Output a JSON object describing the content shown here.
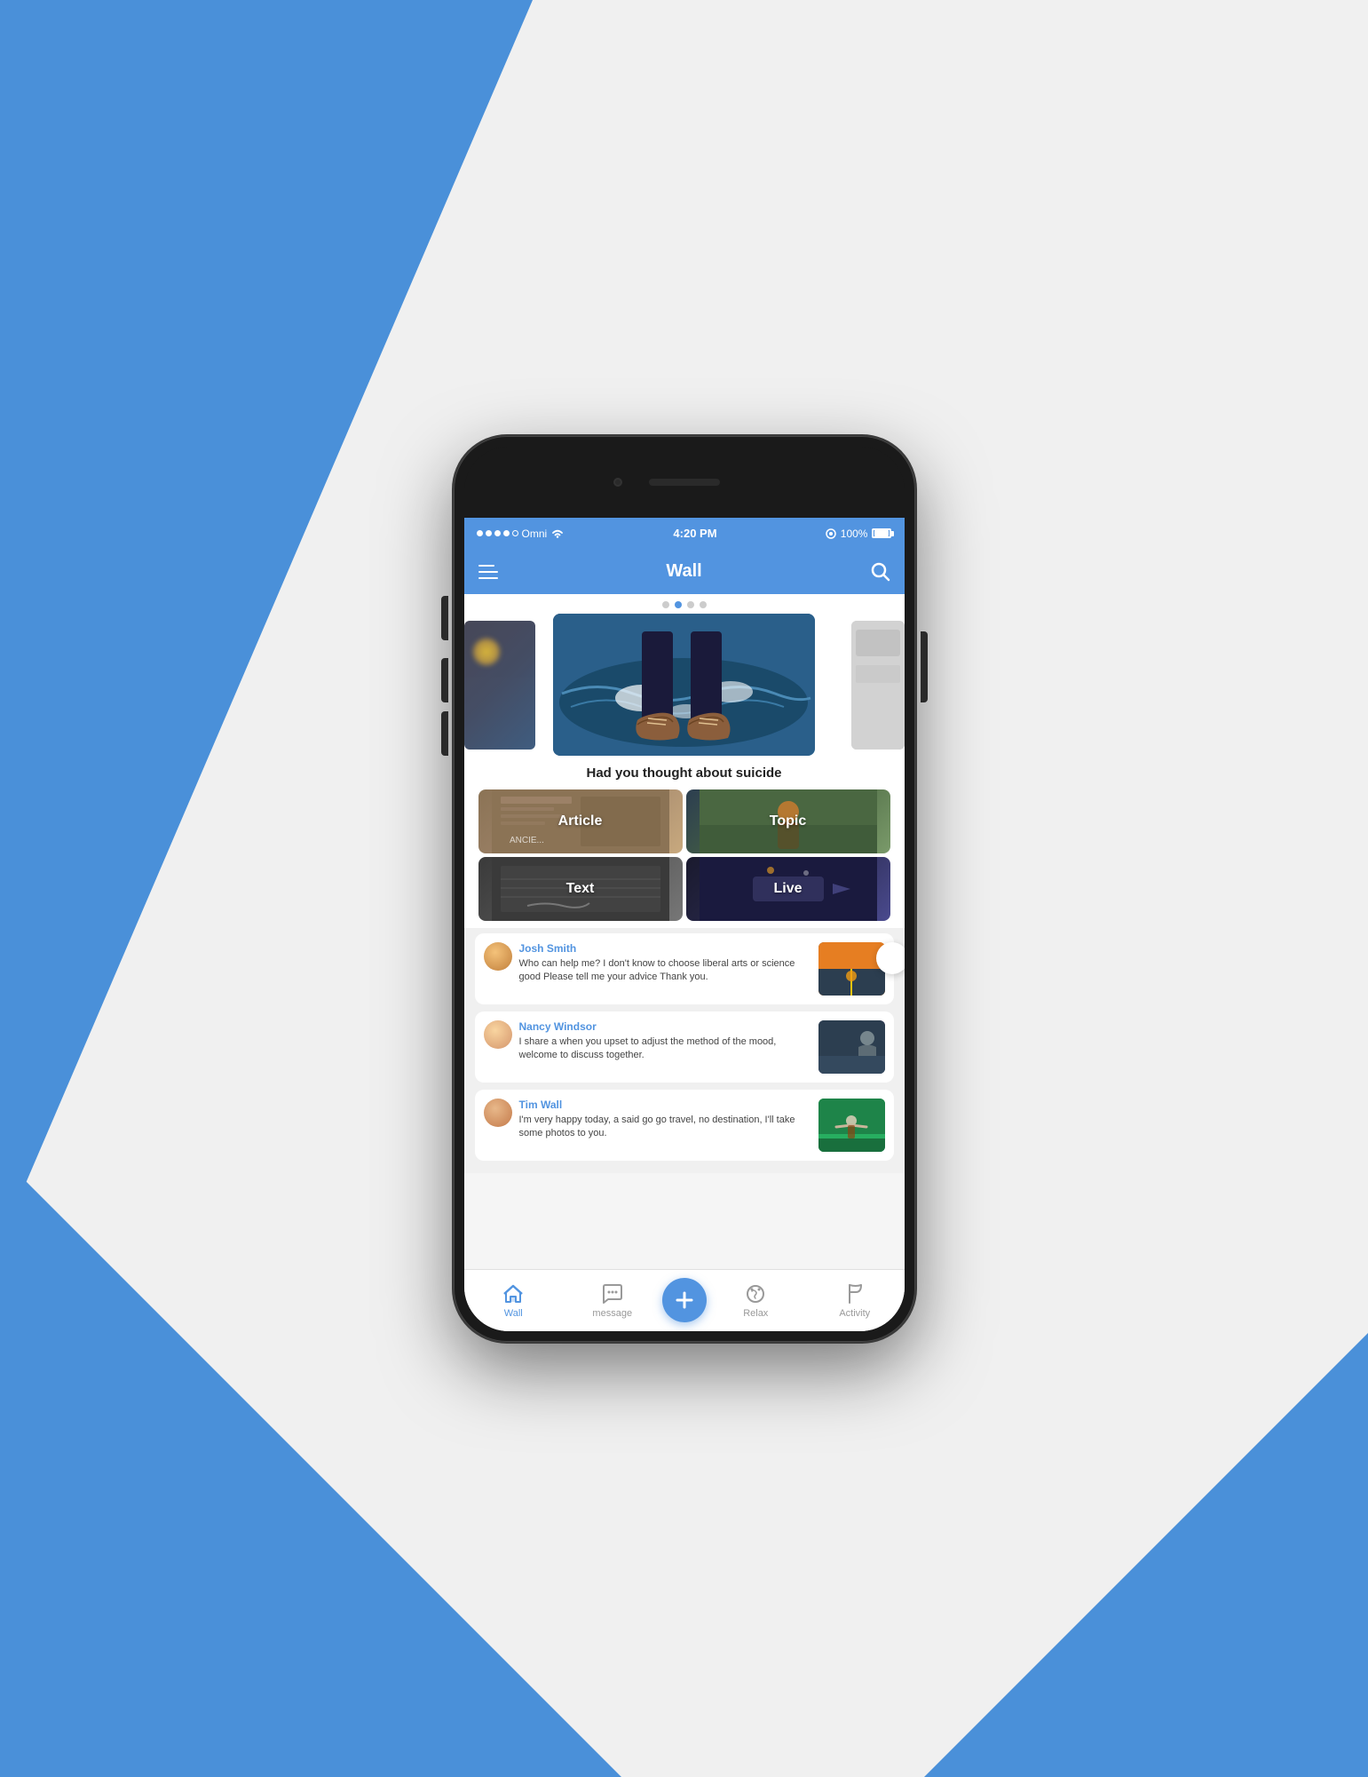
{
  "background": {
    "color1": "#4a90d9",
    "color2": "#ffffff"
  },
  "statusBar": {
    "carrier": "Omni",
    "signal": "wifi",
    "time": "4:20 PM",
    "battery": "100%"
  },
  "header": {
    "title": "Wall",
    "menuIcon": "menu-icon",
    "searchIcon": "search-icon"
  },
  "carousel": {
    "dots": [
      "inactive",
      "active",
      "inactive",
      "inactive"
    ],
    "caption": "Had you thought about suicide"
  },
  "contentGrid": {
    "items": [
      {
        "label": "Article",
        "bg": "article"
      },
      {
        "label": "Topic",
        "bg": "topic"
      },
      {
        "label": "Text",
        "bg": "text"
      },
      {
        "label": "Live",
        "bg": "live"
      }
    ]
  },
  "posts": [
    {
      "username": "Josh Smith",
      "text": "Who can help me? I don't know to choose liberal arts or science good Please tell me your advice Thank you.",
      "thumbBg": "thumb-1"
    },
    {
      "username": "Nancy Windsor",
      "text": "I share a when you upset to adjust the method of the mood, welcome to discuss together.",
      "thumbBg": "thumb-2"
    },
    {
      "username": "Tim Wall",
      "text": "I'm very happy today, a said go go travel, no destination, I'll take some photos to you.",
      "thumbBg": "thumb-3"
    }
  ],
  "bottomNav": {
    "items": [
      {
        "label": "Wall",
        "icon": "home-icon",
        "active": true
      },
      {
        "label": "message",
        "icon": "message-icon",
        "active": false
      },
      {
        "label": "+",
        "icon": "add-icon",
        "active": false,
        "isAdd": true
      },
      {
        "label": "Relax",
        "icon": "relax-icon",
        "active": false
      },
      {
        "label": "Activity",
        "icon": "activity-icon",
        "active": false
      }
    ]
  }
}
